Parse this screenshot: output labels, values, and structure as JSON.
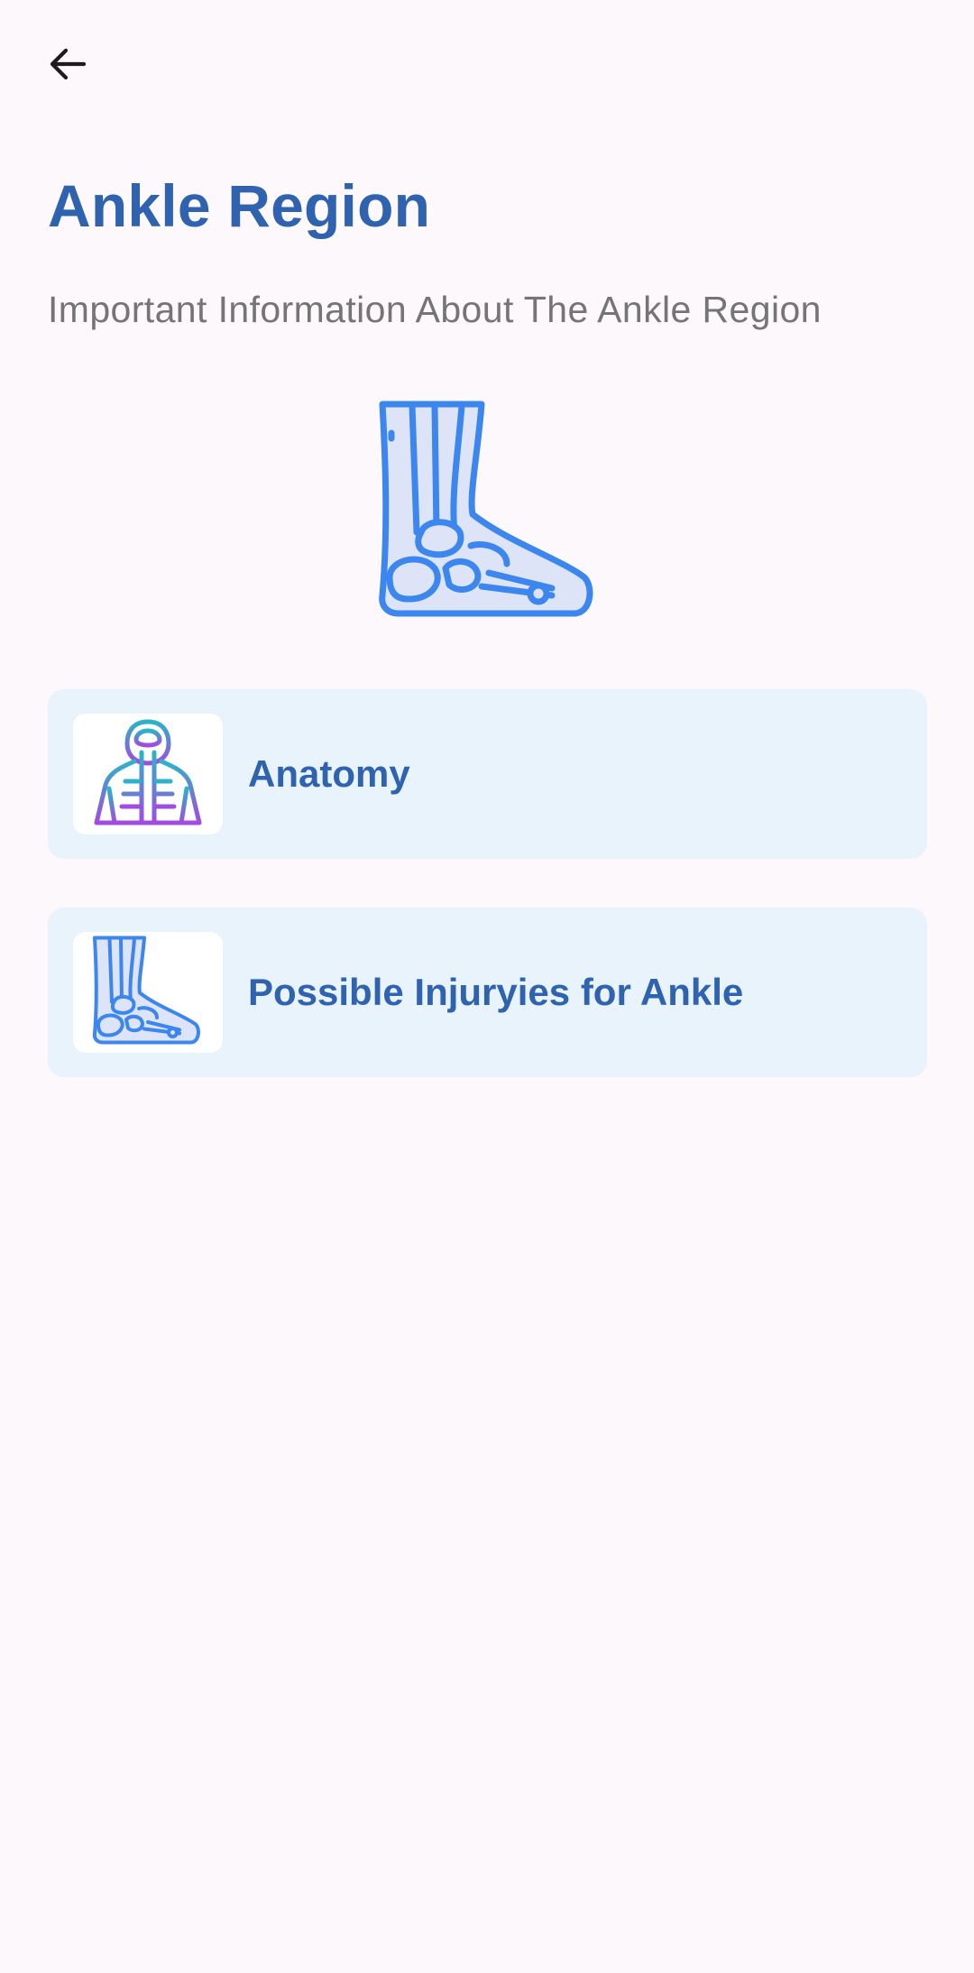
{
  "header": {
    "back_icon": "arrow-left-icon"
  },
  "page": {
    "title": "Ankle Region",
    "subtitle": "Important Information About The Ankle Region",
    "hero_icon": "ankle-skeleton-icon"
  },
  "menu": {
    "items": [
      {
        "label": "Anatomy",
        "icon": "anatomy-torso-icon"
      },
      {
        "label": "Possible Injuryies for Ankle",
        "icon": "ankle-skeleton-icon"
      }
    ]
  },
  "colors": {
    "background": "#fdf8fb",
    "title": "#2f63b0",
    "subtitle": "#757575",
    "card_bg": "#e8f3fc",
    "icon_blue": "#3b86ef",
    "icon_purple": "#9b4de0",
    "icon_teal": "#2bb3c9"
  }
}
